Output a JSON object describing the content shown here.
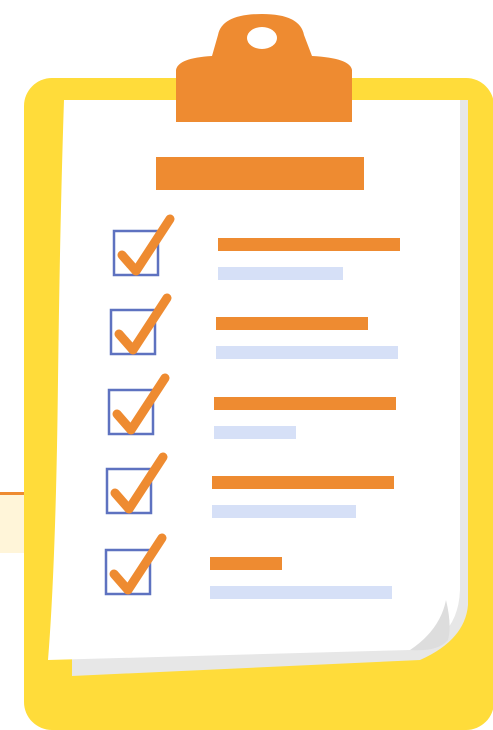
{
  "illustration": {
    "subject": "clipboard-checklist-icon",
    "colors": {
      "board": "#FFDC3A",
      "clip": "#EE8B31",
      "paper": "#FFFFFF",
      "paper_shadow": "#E7E7E7",
      "checkbox_border": "#5E72C0",
      "checkmark": "#EE8B31",
      "primary_line": "#EE8B31",
      "secondary_line": "#D6E0F7",
      "background_band": "#FFF5D9",
      "background_rule": "#EE8B31"
    },
    "title_bar": {
      "icon": "title-bar"
    },
    "items": [
      {
        "checked": true,
        "primary_fill": 0.96,
        "secondary_fill": 0.66
      },
      {
        "checked": true,
        "primary_fill": 0.8,
        "secondary_fill": 0.96
      },
      {
        "checked": true,
        "primary_fill": 0.96,
        "secondary_fill": 0.43
      },
      {
        "checked": true,
        "primary_fill": 0.96,
        "secondary_fill": 0.76
      },
      {
        "checked": true,
        "primary_fill": 0.38,
        "secondary_fill": 0.96
      }
    ]
  }
}
